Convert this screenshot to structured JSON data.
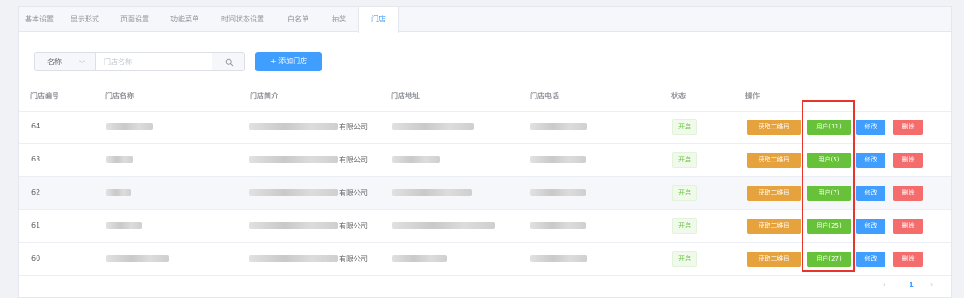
{
  "tabs": [
    {
      "label": "基本设置"
    },
    {
      "label": "显示形式"
    },
    {
      "label": "页面设置"
    },
    {
      "label": "功能菜单"
    },
    {
      "label": "时间状态设置"
    },
    {
      "label": "白名单"
    },
    {
      "label": "抽奖"
    },
    {
      "label": "门店",
      "active": true
    }
  ],
  "search": {
    "select_value": "名称",
    "placeholder": "门店名称"
  },
  "add_button": "+ 添加门店",
  "table": {
    "headers": [
      "门店编号",
      "门店名称",
      "门店简介",
      "门店地址",
      "门店电话",
      "状态",
      "操作"
    ],
    "rows": [
      {
        "id": "64",
        "intro_suffix": "有限公司",
        "status": "开启",
        "qr": "获取二维码",
        "user": "用户(11)",
        "edit": "修改",
        "delete": "删除"
      },
      {
        "id": "63",
        "intro_suffix": "有限公司",
        "status": "开启",
        "qr": "获取二维码",
        "user": "用户(5)",
        "edit": "修改",
        "delete": "删除"
      },
      {
        "id": "62",
        "intro_suffix": "有限公司",
        "status": "开启",
        "qr": "获取二维码",
        "user": "用户(7)",
        "edit": "修改",
        "delete": "删除"
      },
      {
        "id": "61",
        "intro_suffix": "有限公司",
        "status": "开启",
        "qr": "获取二维码",
        "user": "用户(25)",
        "edit": "修改",
        "delete": "删除"
      },
      {
        "id": "60",
        "intro_suffix": "有限公司",
        "status": "开启",
        "qr": "获取二维码",
        "user": "用户(27)",
        "edit": "修改",
        "delete": "删除"
      }
    ]
  },
  "pagination": {
    "prev": "‹",
    "current": "1",
    "next": "›"
  },
  "colors": {
    "primary": "#409eff",
    "success": "#67c23a",
    "warning": "#e6a23c",
    "danger": "#f56c6c",
    "highlight": "#e8352c"
  },
  "icons": {
    "search": "search-icon",
    "select_arrow": "chevron-down-icon"
  }
}
